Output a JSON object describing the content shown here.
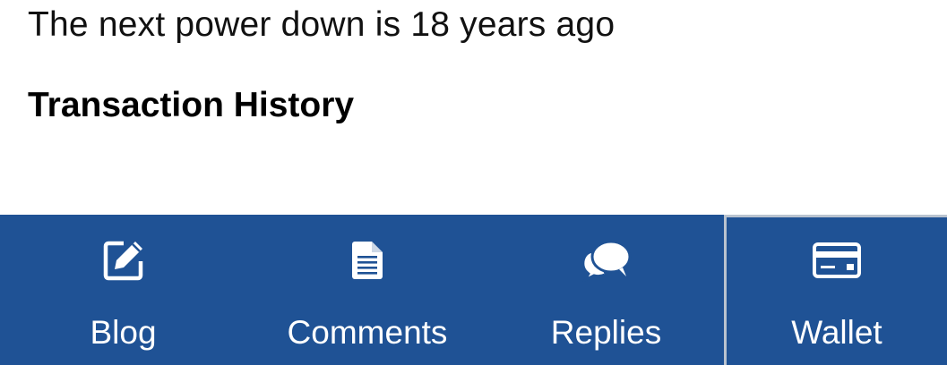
{
  "wallet": {
    "power_down_text": "The next power down is 18 years ago",
    "section_title": "Transaction History"
  },
  "tabbar": {
    "tabs": [
      {
        "label": "Blog",
        "icon": "edit-icon"
      },
      {
        "label": "Comments",
        "icon": "document-icon"
      },
      {
        "label": "Replies",
        "icon": "chat-bubbles-icon"
      },
      {
        "label": "Wallet",
        "icon": "credit-card-icon",
        "active": true
      }
    ],
    "colors": {
      "background": "#1f5295",
      "text": "#ffffff",
      "active_border": "#b9c3cf"
    }
  }
}
